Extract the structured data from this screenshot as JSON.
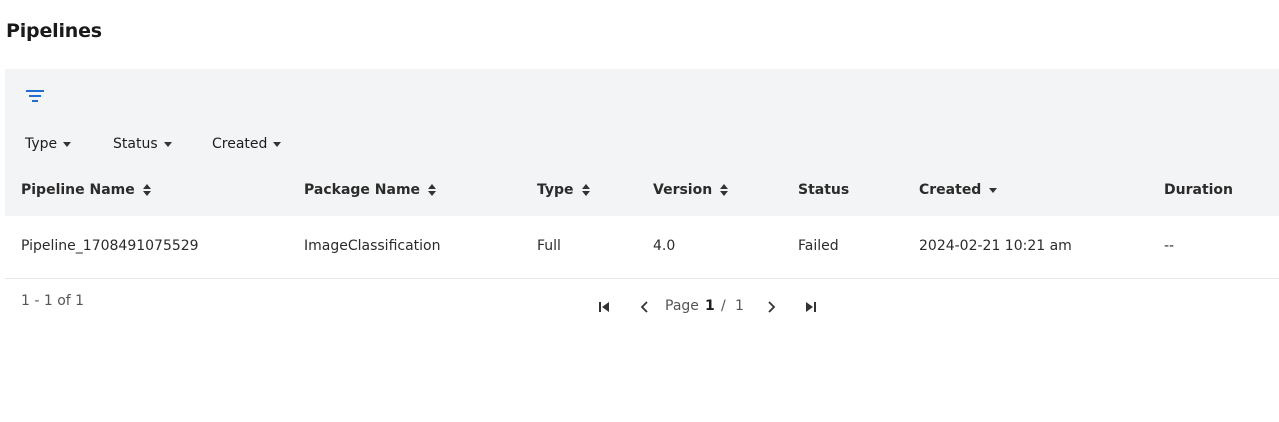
{
  "page": {
    "title": "Pipelines"
  },
  "filters": {
    "icon": "filter-icon",
    "chips": [
      {
        "label": "Type"
      },
      {
        "label": "Status"
      },
      {
        "label": "Created"
      }
    ]
  },
  "table": {
    "columns": [
      {
        "label": "Pipeline Name",
        "sort": "both"
      },
      {
        "label": "Package Name",
        "sort": "both"
      },
      {
        "label": "Type",
        "sort": "both"
      },
      {
        "label": "Version",
        "sort": "both"
      },
      {
        "label": "Status",
        "sort": "none"
      },
      {
        "label": "Created",
        "sort": "desc"
      },
      {
        "label": "Duration",
        "sort": "none"
      }
    ],
    "rows": [
      {
        "pipeline_name": "Pipeline_1708491075529",
        "package_name": "ImageClassification",
        "type": "Full",
        "version": "4.0",
        "status": "Failed",
        "created": "2024-02-21 10:21 am",
        "duration": "--"
      }
    ]
  },
  "pagination": {
    "range_text": "1 - 1 of 1",
    "page_label": "Page",
    "current_page": "1",
    "separator": "/",
    "total_pages": "1"
  }
}
